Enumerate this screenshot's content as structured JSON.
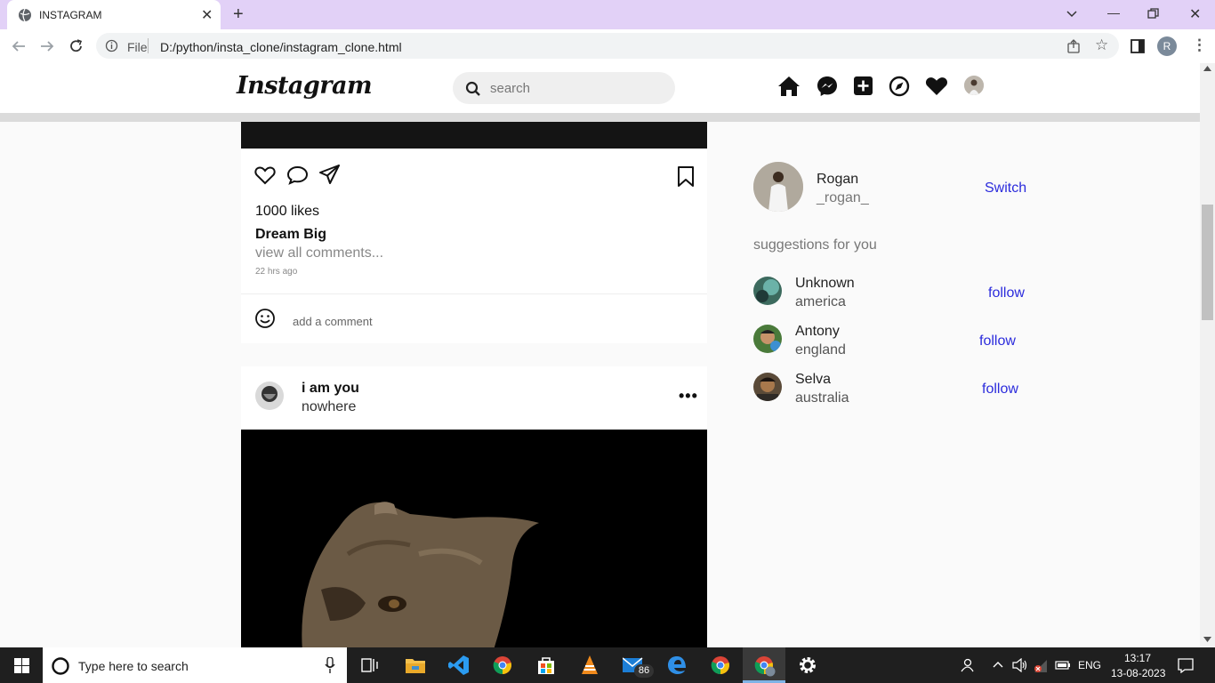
{
  "browser": {
    "tab_title": "INSTAGRAM",
    "url_scheme": "File",
    "url_path": "D:/python/insta_clone/instagram_clone.html",
    "profile_initial": "R"
  },
  "header": {
    "logo": "Instagram",
    "search_placeholder": "search",
    "icons": [
      "home-icon",
      "messenger-icon",
      "add-post-icon",
      "explore-icon",
      "heart-icon",
      "profile-avatar"
    ]
  },
  "post1": {
    "likes": "1000 likes",
    "caption": "Dream Big",
    "view_comments": "view all comments...",
    "time": "22 hrs ago",
    "comment_placeholder": "add a comment"
  },
  "post2": {
    "username": "i am you",
    "location": "nowhere",
    "more": "•••"
  },
  "sidebar": {
    "user": {
      "name": "Rogan",
      "handle": "_rogan_",
      "switch_label": "Switch"
    },
    "suggestions_title": "suggestions for you",
    "suggestions": [
      {
        "name": "Unknown",
        "place": "america",
        "action": "follow"
      },
      {
        "name": "Antony",
        "place": "england",
        "action": "follow"
      },
      {
        "name": "Selva",
        "place": "australia",
        "action": "follow"
      }
    ]
  },
  "taskbar": {
    "search_placeholder": "Type here to search",
    "mail_badge": "86",
    "language": "ENG",
    "time": "13:17",
    "date": "13-08-2023"
  },
  "colors": {
    "link": "#2b2bdc",
    "tab_strip": "#e2d1f7"
  }
}
